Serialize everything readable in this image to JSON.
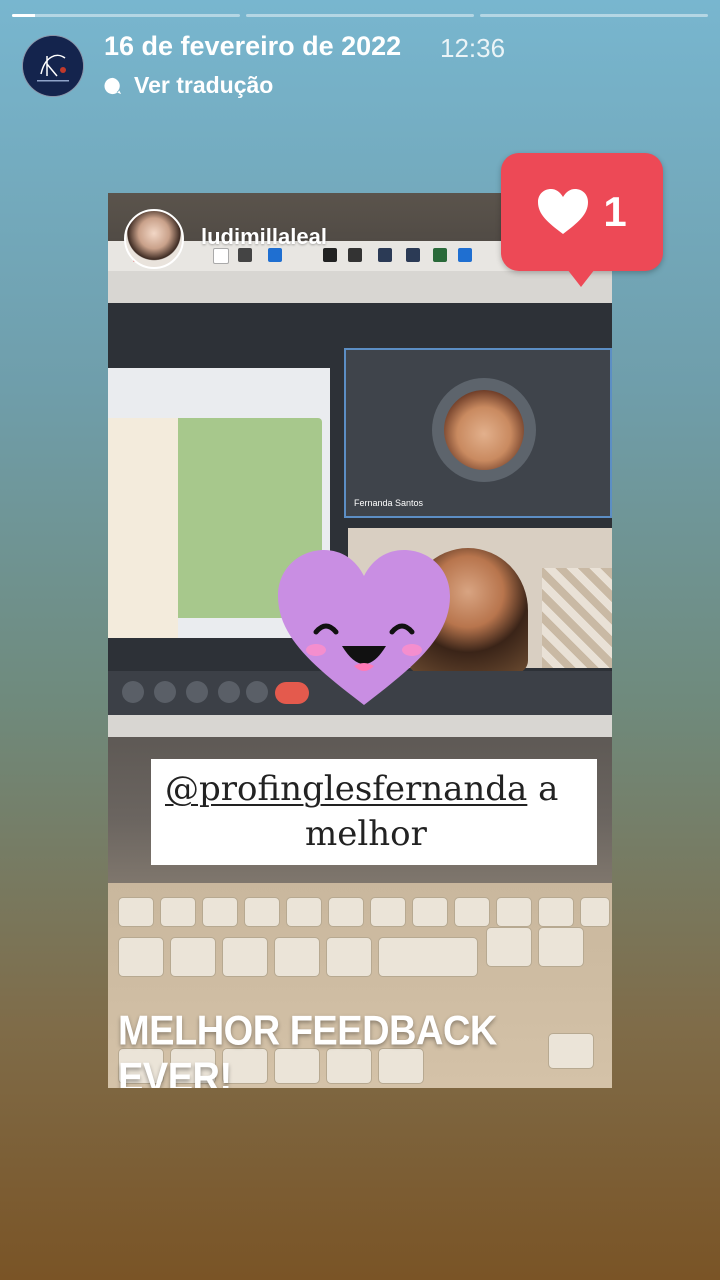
{
  "story": {
    "progress": [
      1,
      0,
      0
    ],
    "progress_current_fraction": 0.1,
    "segment_count": 3
  },
  "header": {
    "date": "16 de fevereiro de 2022",
    "time": "12:36",
    "translate_label": "Ver tradução",
    "avatar_icon": "profile-logo-icon"
  },
  "media": {
    "username": "ludimillaleal",
    "participant_name": "Fernanda Santos",
    "quote_mention": "@profinglesfernanda",
    "quote_rest_1": " a",
    "quote_rest_2": "melhor",
    "caption": "MELHOR FEEDBACK EVER!",
    "sticker_icon": "smiling-heart-sticker-icon"
  },
  "likes": {
    "count": "1",
    "icon": "heart-icon",
    "color": "#ed4956"
  },
  "colors": {
    "background_top": "#78b6cf",
    "background_bottom": "#7a5426",
    "sticker": "#c98ee3"
  }
}
